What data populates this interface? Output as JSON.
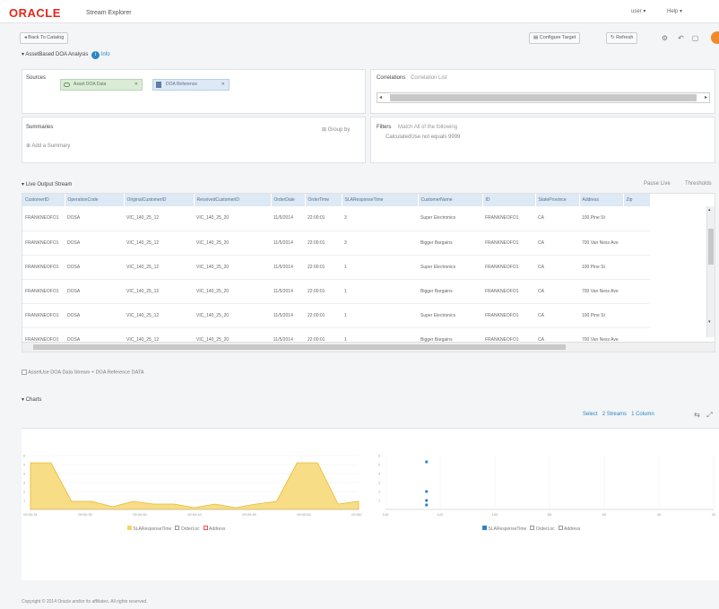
{
  "header": {
    "brand": "ORACLE",
    "product": "Stream Explorer",
    "user_menu": "user",
    "help_menu": "Help"
  },
  "toolbar": {
    "back_label": "Back To Catalog",
    "configure_label": "Configure Target",
    "refresh_label": "Refresh"
  },
  "exploration": {
    "title": "AssetBased DOA Analysis",
    "info_label": "Info",
    "sources_label": "Sources",
    "sources": [
      "Asset DOA Data",
      "DOA Reference"
    ],
    "correlations_label": "Correlations",
    "correlations_value": "Correlation List",
    "summaries_label": "Summaries",
    "group_by_label": "Group by",
    "add_summary": "Add a Summary",
    "filters_label": "Filters",
    "filters_hint": "Match All of the following",
    "filter_condition": "CalculatedUse not equals 9999"
  },
  "live_output": {
    "title": "Live Output Stream",
    "pause_label": "Pause Live",
    "threshold_label": "Thresholds",
    "columns": [
      "CustomerID",
      "OperationCode",
      "OriginalCustomerID",
      "ReceivedCustomerID",
      "OrderDate",
      "OrderTime",
      "SLAResponseTime",
      "CustomerName",
      "ID",
      "StateProvince",
      "Address",
      "Zip"
    ],
    "rows": [
      [
        "FRANKNEOFO1",
        "DOSA",
        "VIC_140_25_12",
        "VIC_140_25_20",
        "11/5/2014",
        "22:00:01",
        "3",
        "Super Electronics",
        "FRANKNEOFO1",
        "CA",
        "100 Pine St",
        ""
      ],
      [
        "FRANKNEOFO1",
        "DOSA",
        "VIC_140_25_12",
        "VIC_140_25_20",
        "11/5/2014",
        "22:00:01",
        "3",
        "Bigger Bargains",
        "FRANKNEOFO1",
        "CA",
        "700 Van Ness Ave",
        ""
      ],
      [
        "FRANKNEOFO1",
        "DOSA",
        "VIC_140_25_12",
        "VIC_140_25_20",
        "11/5/2014",
        "22:00:01",
        "1",
        "Super Electronics",
        "FRANKNEOFO1",
        "CA",
        "100 Pine St",
        ""
      ],
      [
        "FRANKNEOFO1",
        "DOSA",
        "VIC_140_25_12",
        "VIC_140_25_20",
        "11/5/2014",
        "22:00:01",
        "1",
        "Bigger Bargains",
        "FRANKNEOFO1",
        "CA",
        "700 Van Ness Ave",
        ""
      ],
      [
        "FRANKNEOFO1",
        "DOSA",
        "VIC_140_25_12",
        "VIC_140_25_20",
        "11/5/2014",
        "22:00:01",
        "1",
        "Super Electronics",
        "FRANKNEOFO1",
        "CA",
        "100 Pine St",
        ""
      ],
      [
        "FRANKNEOFO1",
        "DOSA",
        "VIC_140_25_12",
        "VIC_140_25_20",
        "11/5/2014",
        "22:00:01",
        "1",
        "Bigger Bargains",
        "FRANKNEOFO1",
        "CA",
        "700 Van Ness Ave",
        ""
      ]
    ],
    "stream_label": "AssetUse DOA Data Stream + DOA Reference DATA"
  },
  "charts_section": {
    "title": "Charts",
    "links": [
      "Select",
      "2 Streams",
      "1 Column"
    ],
    "left_legend": [
      "SLAResponseTime",
      "OrderLoc",
      "Address"
    ],
    "right_legend": [
      "SLAResponseTime",
      "OrderLoc",
      "Address"
    ],
    "accent_area": "#f6d469",
    "accent_line": "#e8b92b",
    "accent_point": "#2a86c9"
  },
  "chart_data": [
    {
      "type": "area",
      "x": [
        "09:00:31",
        "09:00:35",
        "09:00:40",
        "09:00:44",
        "09:00:49",
        "09:00:53",
        "09:00:58"
      ],
      "y_ticks": [
        1,
        2,
        3,
        4,
        5,
        6
      ],
      "series": [
        {
          "values": [
            5.2,
            5.2,
            0.9,
            0.9,
            0.3,
            0.9,
            0.6,
            0.6,
            0.2,
            0.6,
            0.2,
            0.6,
            0.9,
            5.2,
            5.2,
            0.6,
            0.9
          ]
        }
      ]
    },
    {
      "type": "scatter",
      "x_ticks": [
        140,
        120,
        100,
        80,
        60,
        40,
        20
      ],
      "y_ticks": [
        1,
        2,
        3,
        4,
        5,
        6
      ],
      "series": [
        {
          "points": [
            [
              125,
              5.3
            ],
            [
              125,
              2.0
            ],
            [
              125,
              1.0
            ],
            [
              125,
              0.5
            ]
          ]
        }
      ]
    }
  ],
  "footer": {
    "copyright": "Copyright © 2014 Oracle and/or its affiliates. All rights reserved."
  }
}
